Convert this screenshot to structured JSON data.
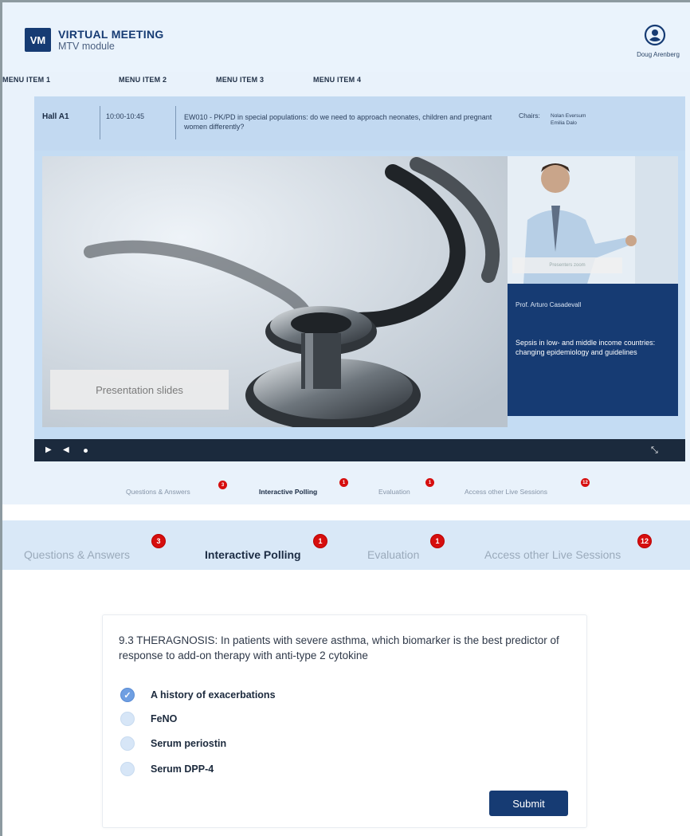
{
  "header": {
    "logo_text": "VM",
    "app_title": "VIRTUAL MEETING",
    "app_subtitle": "MTV module",
    "user_name": "Doug Arenberg",
    "user_icon": "user-circle-icon"
  },
  "menu": {
    "items": [
      {
        "label": "MENU ITEM 1"
      },
      {
        "label": "MENU ITEM 2"
      },
      {
        "label": "MENU ITEM 3"
      },
      {
        "label": "MENU ITEM 4"
      }
    ]
  },
  "session": {
    "hall": "Hall A1",
    "time": "10:00-10:45",
    "title": "EW010 - PK/PD in special populations: do we need to approach neonates, children and pregnant women differently?",
    "chairs_label": "Chairs:",
    "chairs": [
      "Nolan Eversum",
      "Emilia Dalo"
    ]
  },
  "video": {
    "slides_label": "Presentation slides",
    "presenter_label": "Presenters zoom",
    "speaker_name": "Prof. Arturo Casadevall",
    "speaker_topic": "Sepsis in low- and middle income countries: changing epidemiology and guidelines",
    "controls": {
      "play_icon": "play-icon",
      "volume_icon": "volume-icon",
      "fullscreen_icon": "expand-icon"
    }
  },
  "tabs": [
    {
      "label": "Questions & Answers",
      "badge": "3",
      "active": false
    },
    {
      "label": "Interactive Polling",
      "badge": "1",
      "active": true
    },
    {
      "label": "Evaluation",
      "badge": "1",
      "active": false
    },
    {
      "label": "Access other Live Sessions",
      "badge": "12",
      "active": false
    }
  ],
  "poll": {
    "question": "9.3 THERAGNOSIS: In patients with severe asthma, which biomarker is the best predictor of response to add-on therapy with anti-type 2 cytokine",
    "options": [
      {
        "label": "A history of exacerbations",
        "selected": true
      },
      {
        "label": "FeNO",
        "selected": false
      },
      {
        "label": "Serum periostin",
        "selected": false
      },
      {
        "label": "Serum DPP-4",
        "selected": false
      }
    ],
    "submit_label": "Submit"
  },
  "colors": {
    "brand": "#163b73",
    "badge": "#d60e0e",
    "page_bg": "#e9f2fb",
    "radio_selected": "#6f9fe2"
  }
}
